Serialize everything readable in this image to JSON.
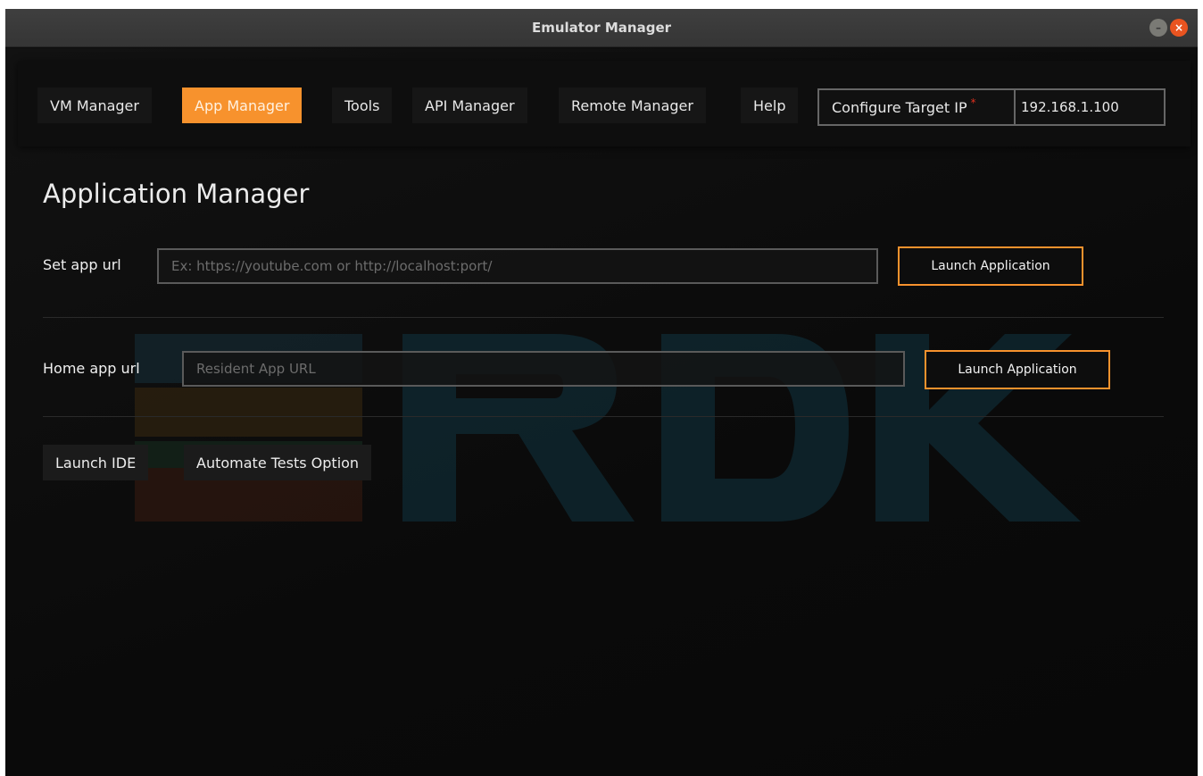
{
  "window": {
    "title": "Emulator Manager",
    "minimize_glyph": "–",
    "close_glyph": "×"
  },
  "nav": {
    "items": [
      {
        "label": "VM Manager",
        "active": false
      },
      {
        "label": "App Manager",
        "active": true
      },
      {
        "label": "Tools",
        "active": false
      },
      {
        "label": "API Manager",
        "active": false
      },
      {
        "label": "Remote Manager",
        "active": false
      },
      {
        "label": "Help",
        "active": false
      }
    ],
    "target_ip": {
      "label": "Configure Target IP",
      "required_mark": "*",
      "value": "192.168.1.100"
    }
  },
  "main": {
    "title": "Application Manager",
    "set_app": {
      "label": "Set app url",
      "placeholder": "Ex: https://youtube.com or http://localhost:port/",
      "button_label": "Launch Application"
    },
    "home_app": {
      "label": "Home app url",
      "placeholder": "Resident App URL",
      "button_label": "Launch Application"
    },
    "actions": {
      "launch_ide": "Launch IDE",
      "automate_tests": "Automate Tests Option"
    }
  },
  "colors": {
    "accent": "#f7922d",
    "background": "#0c0c0c",
    "close_button": "#e95420"
  }
}
